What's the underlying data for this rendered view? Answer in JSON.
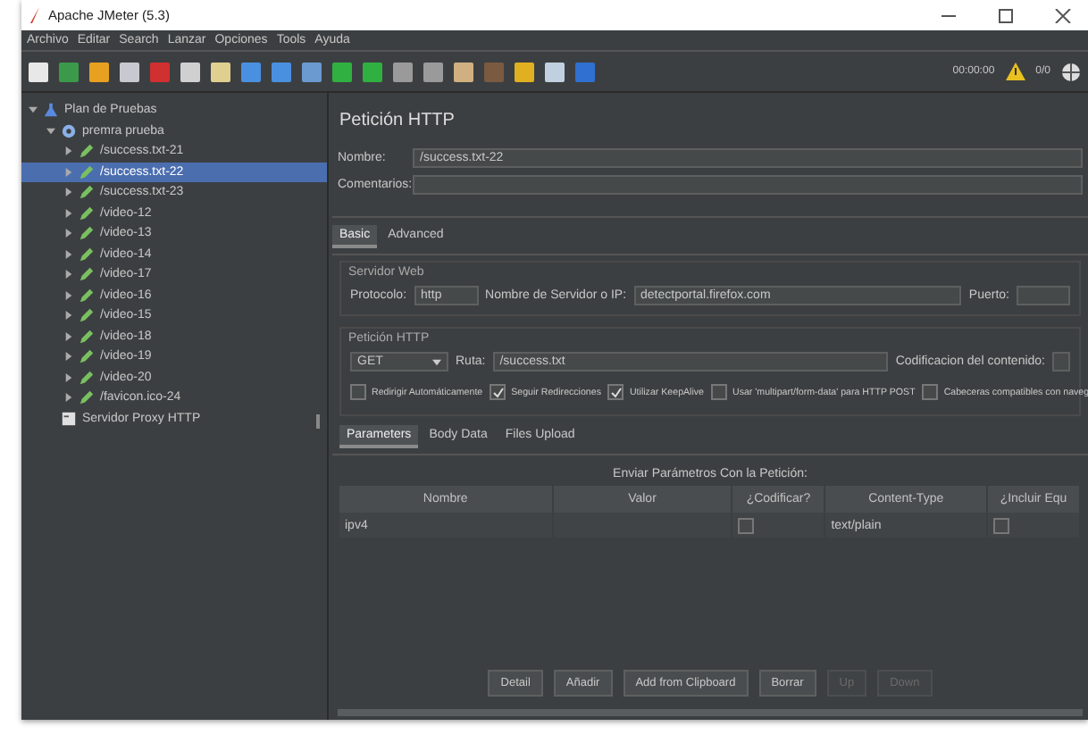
{
  "window": {
    "title": "Apache JMeter (5.3)"
  },
  "menu": [
    "Archivo",
    "Editar",
    "Search",
    "Lanzar",
    "Opciones",
    "Tools",
    "Ayuda"
  ],
  "toolbar": {
    "timer": "00:00:00",
    "threads": "0/0"
  },
  "tree": [
    {
      "label": "Plan de Pruebas",
      "kind": "plan",
      "expanded": true,
      "selected": false,
      "children": [
        {
          "label": "premra prueba",
          "kind": "group",
          "expanded": true,
          "selected": false,
          "children": [
            {
              "label": "/success.txt-21",
              "kind": "sampler",
              "expanded": false,
              "selected": false
            },
            {
              "label": "/success.txt-22",
              "kind": "sampler",
              "expanded": false,
              "selected": true
            },
            {
              "label": "/success.txt-23",
              "kind": "sampler",
              "expanded": false,
              "selected": false
            },
            {
              "label": "/video-12",
              "kind": "sampler",
              "expanded": false,
              "selected": false
            },
            {
              "label": "/video-13",
              "kind": "sampler",
              "expanded": false,
              "selected": false
            },
            {
              "label": "/video-14",
              "kind": "sampler",
              "expanded": false,
              "selected": false
            },
            {
              "label": "/video-17",
              "kind": "sampler",
              "expanded": false,
              "selected": false
            },
            {
              "label": "/video-16",
              "kind": "sampler",
              "expanded": false,
              "selected": false
            },
            {
              "label": "/video-15",
              "kind": "sampler",
              "expanded": false,
              "selected": false
            },
            {
              "label": "/video-18",
              "kind": "sampler",
              "expanded": false,
              "selected": false
            },
            {
              "label": "/video-19",
              "kind": "sampler",
              "expanded": false,
              "selected": false
            },
            {
              "label": "/video-20",
              "kind": "sampler",
              "expanded": false,
              "selected": false
            },
            {
              "label": "/favicon.ico-24",
              "kind": "sampler",
              "expanded": false,
              "selected": false
            }
          ]
        },
        {
          "label": "Servidor Proxy HTTP",
          "kind": "proxy",
          "selected": false
        }
      ]
    }
  ],
  "panel": {
    "title": "Petición HTTP",
    "name_label": "Nombre:",
    "name_value": "/success.txt-22",
    "comments_label": "Comentarios:",
    "tabs": [
      {
        "label": "Basic",
        "selected": true
      },
      {
        "label": "Advanced",
        "selected": false
      }
    ],
    "server_group": "Servidor Web",
    "protocol_label": "Protocolo:",
    "protocol_value": "http",
    "server_label": "Nombre de Servidor o IP:",
    "server_value": "detectportal.firefox.com",
    "port_label": "Puerto:",
    "request_group": "Petición HTTP",
    "method": "GET",
    "path_label": "Ruta:",
    "path_value": "/success.txt",
    "encoding_label": "Codificacion del contenido:",
    "options": [
      {
        "label": "Redirigir Automáticamente",
        "checked": false
      },
      {
        "label": "Seguir Redirecciones",
        "checked": true
      },
      {
        "label": "Utilizar KeepAlive",
        "checked": true
      },
      {
        "label": "Usar 'multipart/form-data' para HTTP POST",
        "checked": false
      },
      {
        "label": "Cabeceras compatibles con naveg",
        "checked": false
      }
    ],
    "param_tabs": [
      {
        "label": "Parameters",
        "selected": true
      },
      {
        "label": "Body Data",
        "selected": false
      },
      {
        "label": "Files Upload",
        "selected": false
      }
    ],
    "table": {
      "title": "Enviar Parámetros Con la Petición:",
      "columns": [
        "Nombre",
        "Valor",
        "¿Codificar?",
        "Content-Type",
        "¿Incluir Equ"
      ],
      "rows": [
        {
          "name": "ipv4",
          "value": "",
          "encode": false,
          "content_type": "text/plain",
          "include_equals": false
        }
      ]
    },
    "buttons": [
      {
        "label": "Detail",
        "disabled": false
      },
      {
        "label": "Añadir",
        "disabled": false
      },
      {
        "label": "Add from Clipboard",
        "disabled": false
      },
      {
        "label": "Borrar",
        "disabled": false
      },
      {
        "label": "Up",
        "disabled": true
      },
      {
        "label": "Down",
        "disabled": true
      }
    ]
  }
}
